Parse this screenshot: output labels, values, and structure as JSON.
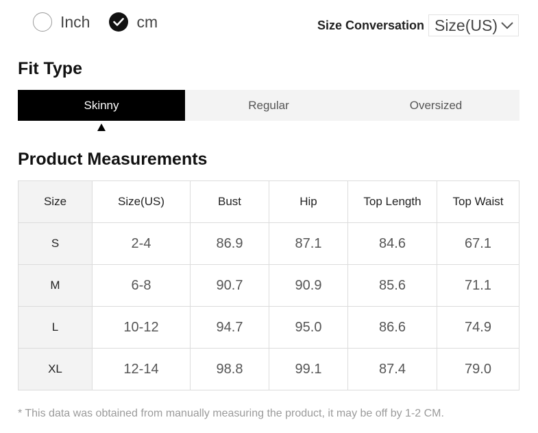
{
  "units": {
    "options": [
      {
        "label": "Inch",
        "selected": false
      },
      {
        "label": "cm",
        "selected": true
      }
    ]
  },
  "size_conversion": {
    "label": "Size Conversation",
    "selected": "Size(US)"
  },
  "fit_type": {
    "title": "Fit Type",
    "tabs": [
      "Skinny",
      "Regular",
      "Oversized"
    ],
    "active": "Skinny"
  },
  "measurements": {
    "title": "Product Measurements",
    "headers": [
      "Size",
      "Size(US)",
      "Bust",
      "Hip",
      "Top Length",
      "Top Waist"
    ],
    "rows": [
      [
        "S",
        "2-4",
        "86.9",
        "87.1",
        "84.6",
        "67.1"
      ],
      [
        "M",
        "6-8",
        "90.7",
        "90.9",
        "85.6",
        "71.1"
      ],
      [
        "L",
        "10-12",
        "94.7",
        "95.0",
        "86.6",
        "74.9"
      ],
      [
        "XL",
        "12-14",
        "98.8",
        "99.1",
        "87.4",
        "79.0"
      ]
    ]
  },
  "note": "* This data was obtained from manually measuring the product, it may be off by 1-2 CM.",
  "icons": {
    "check": "checkmark-icon",
    "dropdown": "chevron-down-icon",
    "pointer": "triangle-up-icon"
  },
  "colors": {
    "active_tab_bg": "#000000",
    "tab_bg": "#f3f3f3",
    "header_cell_bg": "#f3f3f3",
    "note_text": "#9a9a9a"
  }
}
